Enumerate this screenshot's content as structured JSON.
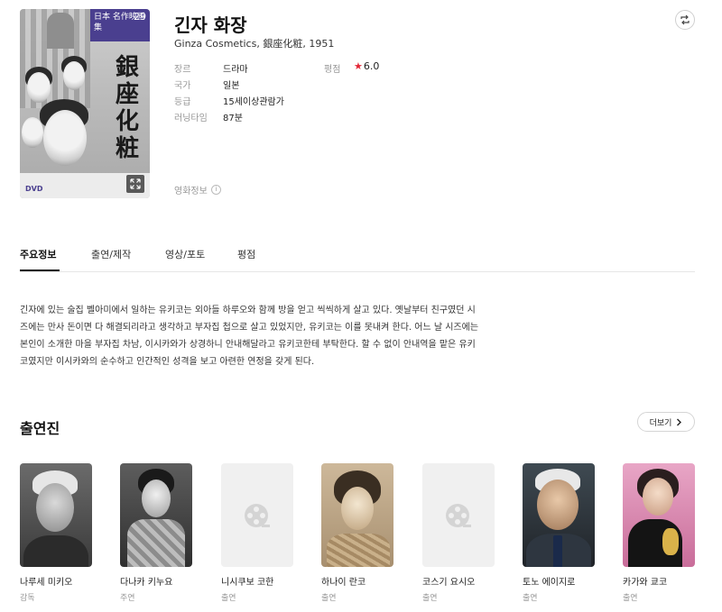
{
  "poster": {
    "badge_text": "日本 名作映画集",
    "badge_number": "29",
    "title_jp": "銀座化粧"
  },
  "movie": {
    "title": "긴자 화장",
    "subtitle": "Ginza Cosmetics, 銀座化粧, 1951"
  },
  "meta": [
    {
      "label": "장르",
      "value": "드라마"
    },
    {
      "label": "국가",
      "value": "일본"
    },
    {
      "label": "등급",
      "value": "15세이상관람가"
    },
    {
      "label": "러닝타임",
      "value": "87분"
    }
  ],
  "rating": {
    "label": "평점",
    "star": "★",
    "value": "6.0",
    "star_color": "#e32636"
  },
  "movie_info_link": "영화정보",
  "tabs": [
    {
      "label": "주요정보",
      "active": true
    },
    {
      "label": "출연/제작",
      "active": false
    },
    {
      "label": "영상/포토",
      "active": false
    },
    {
      "label": "평점",
      "active": false
    }
  ],
  "synopsis": [
    "긴자에 있는 술집 벨아미에서 일하는 유키코는 외아들 하루오와 함께 방을 얻고 씩씩하게 살고 있다. 옛날부터 친구였던 시",
    "즈에는 만사 돈이면 다 해결되리라고 생각하고 부자집 첩으로 살고 있었지만, 유키코는 이를 못내켜 한다. 어느 날 시즈에는",
    "본인이 소개한 마을 부자집 차남, 이시카와가 상경하니 안내해달라고 유키코한테 부탁한다. 할 수 없이 안내역을 맡은 유키",
    "코였지만 이시카와의 순수하고 인간적인 성격을 보고 아련한 연정을 갖게 된다."
  ],
  "cast_section": {
    "title": "출연진",
    "more_label": "더보기"
  },
  "cast": [
    {
      "name": "나루세 미키오",
      "role": "감독",
      "photo": "bw-man"
    },
    {
      "name": "다나카 키누요",
      "role": "주연",
      "photo": "bw-woman"
    },
    {
      "name": "니시쿠보 코한",
      "role": "출연",
      "photo": "placeholder"
    },
    {
      "name": "하나이 란코",
      "role": "출연",
      "photo": "sepia-woman"
    },
    {
      "name": "코스기 요시오",
      "role": "출연",
      "photo": "placeholder"
    },
    {
      "name": "토노 에이지로",
      "role": "출연",
      "photo": "color-man"
    },
    {
      "name": "카가와 쿄코",
      "role": "출연",
      "photo": "color-woman"
    }
  ]
}
